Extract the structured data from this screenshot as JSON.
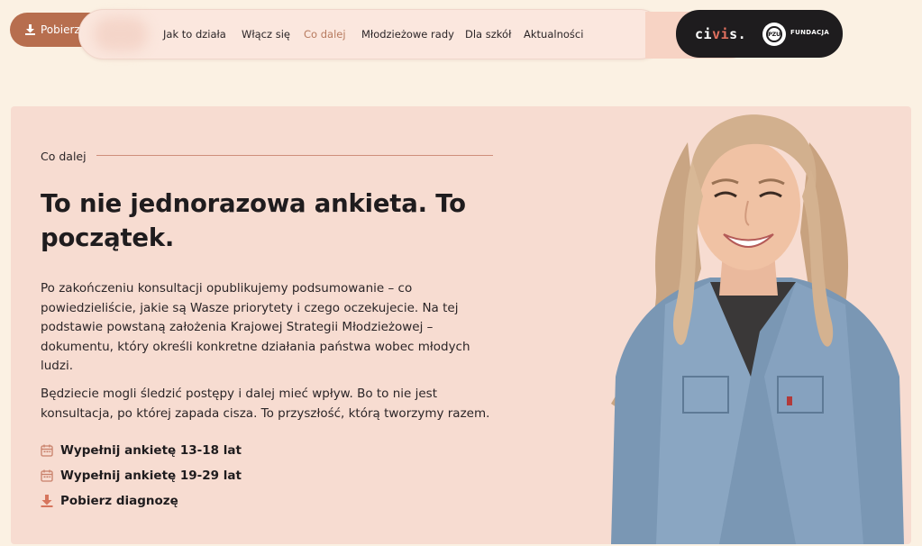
{
  "header": {
    "download_label": "Pobierz",
    "nav": [
      {
        "label": "Jak to działa",
        "active": false
      },
      {
        "label": "Włącz się",
        "active": false
      },
      {
        "label": "Co dalej",
        "active": true
      },
      {
        "label": "Młodzieżowe rady",
        "active": false
      },
      {
        "label": "Dla szkół",
        "active": false
      },
      {
        "label": "Aktualności",
        "active": false
      }
    ],
    "partners": {
      "civis_pre": "ci",
      "civis_accent": "vi",
      "civis_post": "s.",
      "pzu_mark": "PZU",
      "fundacja": "FUNDACJA"
    }
  },
  "hero": {
    "section_label": "Co dalej",
    "headline": "To nie jednorazowa ankieta. To początek.",
    "paragraph1": "Po zakończeniu konsultacji opublikujemy podsumowanie – co powiedzieliście, jakie są Wasze priorytety i czego oczekujecie. Na tej podstawie powstaną założenia Krajowej Strategii Młodzieżowej – dokumentu, który określi konkretne działania państwa wobec młodych ludzi.",
    "paragraph2": "Będziecie mogli śledzić postępy i dalej mieć wpływ. Bo to nie jest konsultacja, po której zapada cisza. To przyszłość, którą tworzymy razem.",
    "links": [
      {
        "label": "Wypełnij ankietę 13-18 lat",
        "icon": "calendar-icon"
      },
      {
        "label": "Wypełnij ankietę 19-29 lat",
        "icon": "calendar-icon"
      },
      {
        "label": "Pobierz diagnozę",
        "icon": "download-icon"
      }
    ]
  },
  "colors": {
    "page_bg": "#fbf1e3",
    "card_bg": "#f7dcd1",
    "accent": "#b76e4e",
    "dark": "#1e1c1e"
  }
}
